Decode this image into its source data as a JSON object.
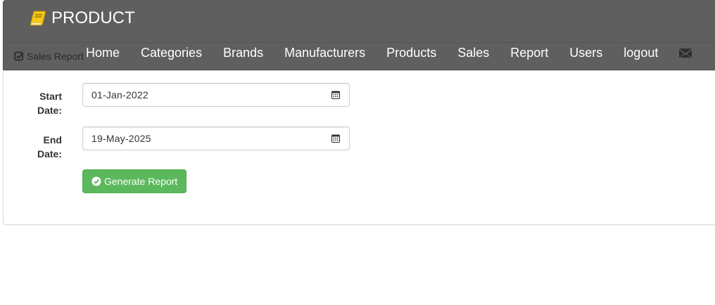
{
  "brand": {
    "title": "PRODUCT",
    "icon": "book-icon",
    "icon_color": "#f5c518"
  },
  "subnav": {
    "label": "Sales Report",
    "icon": "check-square-icon"
  },
  "nav": {
    "items": [
      {
        "label": "Home"
      },
      {
        "label": "Categories"
      },
      {
        "label": "Brands"
      },
      {
        "label": "Manufacturers"
      },
      {
        "label": "Products"
      },
      {
        "label": "Sales"
      },
      {
        "label": "Report"
      },
      {
        "label": "Users"
      },
      {
        "label": "logout"
      }
    ],
    "mail_icon": "envelope-icon"
  },
  "form": {
    "start_date": {
      "label_line1": "Start",
      "label_line2": "Date:",
      "value": "01-Jan-2022",
      "icon": "calendar-icon"
    },
    "end_date": {
      "label_line1": "End",
      "label_line2": "Date:",
      "value": "19-May-2025",
      "icon": "calendar-icon"
    },
    "submit": {
      "label": "Generate Report",
      "icon": "check-circle-icon"
    }
  },
  "colors": {
    "navbar": "#5f5f5f",
    "success": "#5cb85c"
  }
}
